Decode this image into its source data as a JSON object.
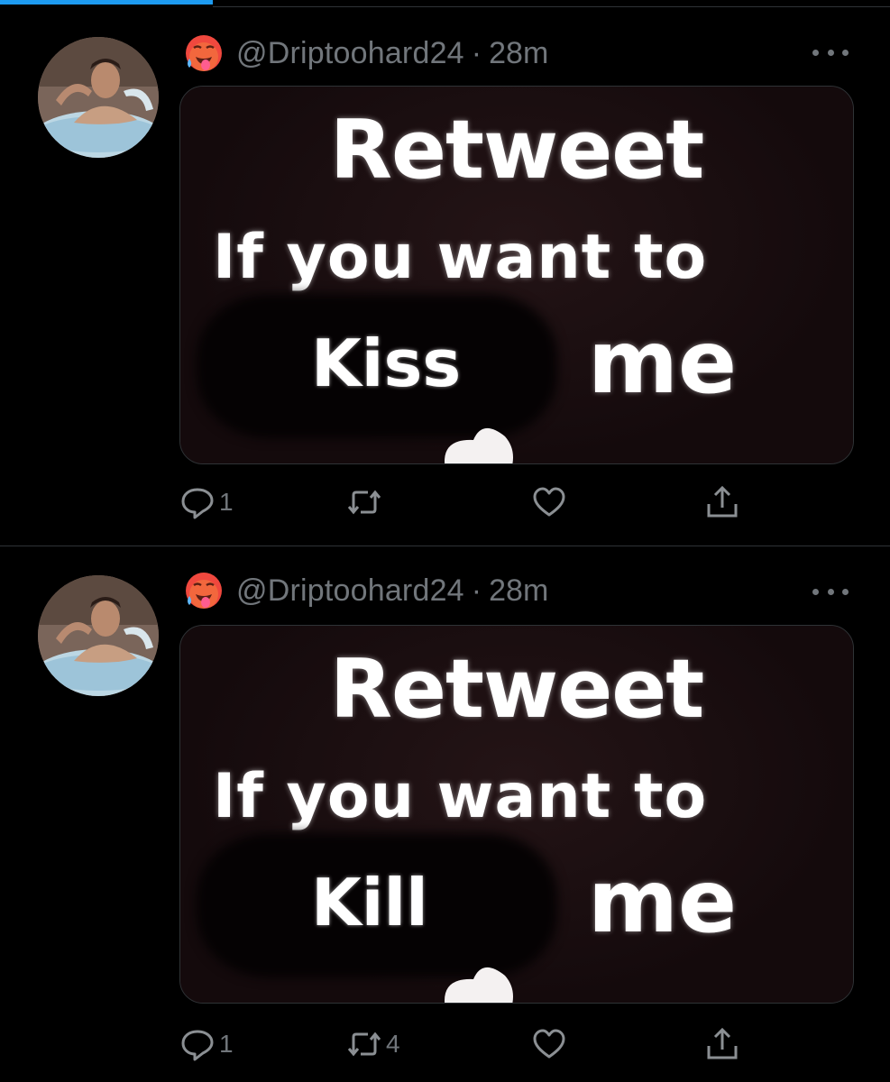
{
  "tweets": [
    {
      "handle": "@Driptoohard24",
      "separator": "·",
      "time": "28m",
      "media": {
        "line1": "Retweet",
        "line2": "If you want to",
        "word": "Kiss",
        "end": "me"
      },
      "counts": {
        "reply": "1",
        "retweet": "",
        "like": ""
      }
    },
    {
      "handle": "@Driptoohard24",
      "separator": "·",
      "time": "28m",
      "media": {
        "line1": "Retweet",
        "line2": "If you want to",
        "word": "Kill",
        "end": "me"
      },
      "counts": {
        "reply": "1",
        "retweet": "4",
        "like": ""
      }
    }
  ],
  "icons": {
    "profile_emoji": "hot-face-emoji",
    "more": "more-options-icon",
    "reply": "reply-icon",
    "retweet": "retweet-icon",
    "like": "heart-icon",
    "share": "share-icon"
  },
  "colors": {
    "background": "#000000",
    "muted": "#71767b",
    "accent": "#1d9bf0",
    "divider": "#2f3336"
  }
}
